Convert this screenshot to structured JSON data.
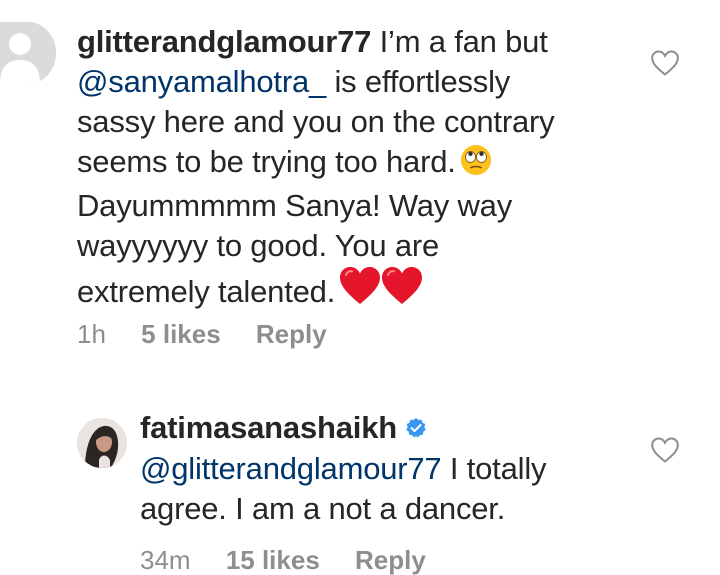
{
  "comments": [
    {
      "username": "glitterandglamour77",
      "lines": [
        "I’m a fan but",
        "@sanyamalhotra_",
        "is effortlessly",
        "sassy here and you on the contrary",
        "seems to be trying too hard.",
        "Dayummmmm Sanya! Way way",
        "wayyyyyy to good. You are",
        "extremely talented."
      ],
      "emoji": {
        "eye_roll": "face-with-rolling-eyes-icon",
        "hearts": "red-heart-icon"
      },
      "time": "1h",
      "likes": "5 likes",
      "reply": "Reply",
      "icon": "heart-outline-icon"
    },
    {
      "username": "fatimasanashaikh",
      "verified": true,
      "mention": "@glitterandglamour77",
      "lines": [
        "I totally",
        "agree. I am a not a dancer."
      ],
      "time": "34m",
      "likes": "15 likes",
      "reply": "Reply",
      "icon": "heart-outline-icon"
    }
  ],
  "colors": {
    "mention": "#003569",
    "meta": "#8e8e8e",
    "verified": "#3897f0",
    "heart_emoji": "#e5152b"
  }
}
